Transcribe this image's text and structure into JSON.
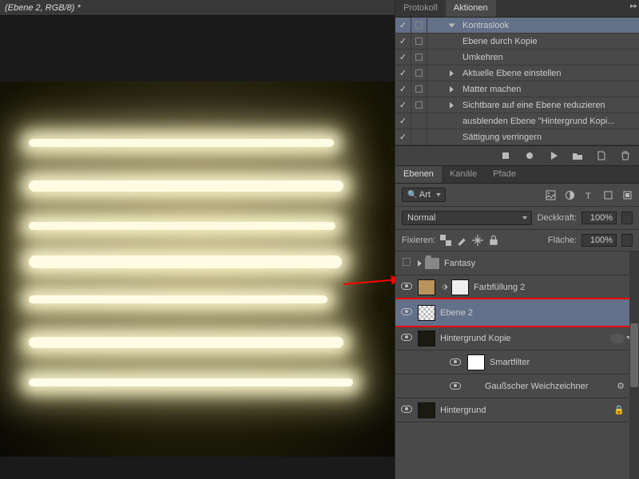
{
  "document": {
    "title": "(Ebene 2, RGB/8) *"
  },
  "top_panel": {
    "tabs": {
      "protocol": "Protokoll",
      "actions": "Aktionen"
    },
    "action_set": "Kontraslook",
    "actions": [
      "Ebene durch Kopie",
      "Umkehren",
      "Aktuelle Ebene einstellen",
      "Matter machen",
      "Sichtbare auf eine Ebene reduzieren",
      "ausblenden Ebene \"Hintergrund Kopi...",
      "Sättigung verringern"
    ]
  },
  "layers_panel": {
    "tabs": {
      "layers": "Ebenen",
      "channels": "Kanäle",
      "paths": "Pfade"
    },
    "filter_label": "Art",
    "blend_mode": "Normal",
    "opacity_label": "Deckkraft:",
    "opacity_value": "100%",
    "lock_label": "Fixieren:",
    "fill_label": "Fläche:",
    "fill_value": "100%",
    "layers": {
      "fantasy": "Fantasy",
      "farbfullung": "Farbfüllung 2",
      "ebene2": "Ebene 2",
      "hgkopie": "Hintergrund Kopie",
      "smartfilter": "Smartfilter",
      "gauss": "Gaußscher Weichzeichner",
      "hintergrund": "Hintergrund"
    }
  }
}
